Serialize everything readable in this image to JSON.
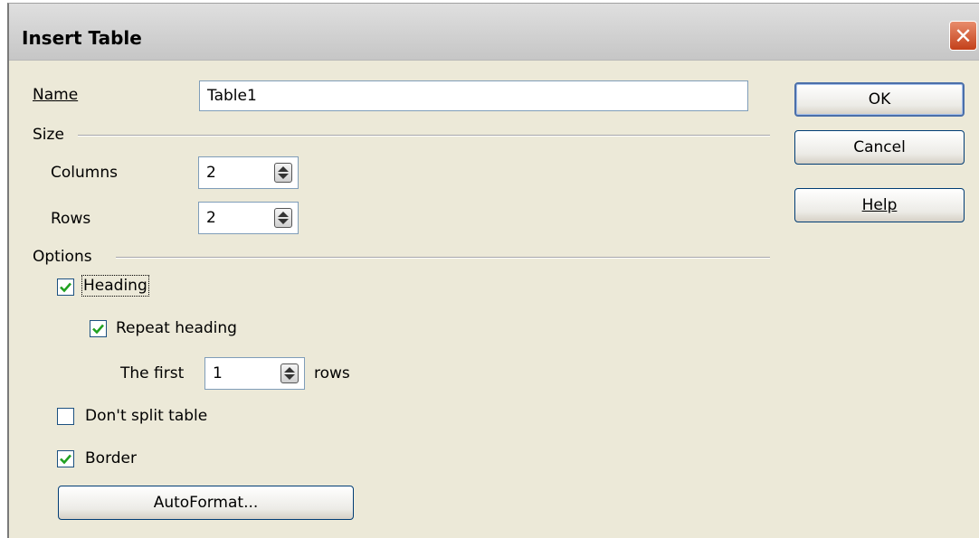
{
  "dialog": {
    "title": "Insert Table",
    "close_glyph": "✕"
  },
  "name_field": {
    "label": "Name",
    "value": "Table1"
  },
  "size_section": {
    "label": "Size",
    "columns_label": "Columns",
    "columns_value": "2",
    "rows_label": "Rows",
    "rows_value": "2"
  },
  "options_section": {
    "label": "Options",
    "heading_label": "Heading",
    "heading_checked": true,
    "repeat_heading_label": "Repeat heading",
    "repeat_heading_checked": true,
    "first_label": "The first",
    "first_value": "1",
    "rows_suffix": "rows",
    "dont_split_label": "Don't split table",
    "dont_split_checked": false,
    "border_label": "Border",
    "border_checked": true,
    "autoformat_label": "AutoFormat..."
  },
  "buttons": {
    "ok": "OK",
    "cancel": "Cancel",
    "help": "Help"
  },
  "colors": {
    "check_mark": "#21a121",
    "dialog_bg": "#ece9d8"
  }
}
